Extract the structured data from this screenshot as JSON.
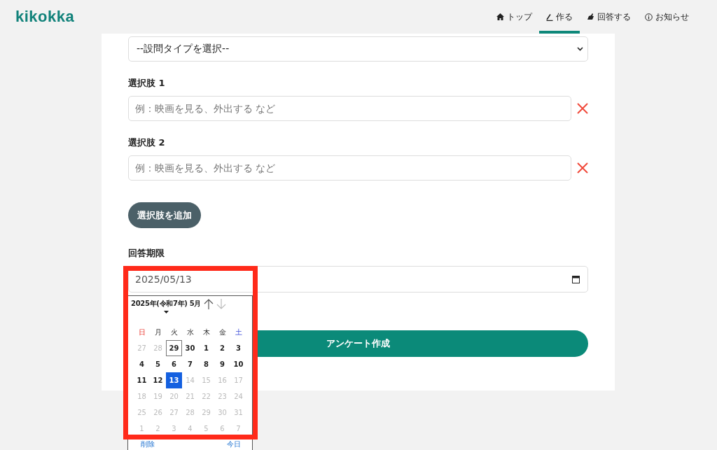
{
  "header": {
    "logo": "kikokka",
    "nav": [
      {
        "label": "トップ",
        "kind": "home",
        "selected": false
      },
      {
        "label": "作る",
        "kind": "create",
        "selected": true
      },
      {
        "label": "回答する",
        "kind": "answer",
        "selected": false
      },
      {
        "label": "お知らせ",
        "kind": "notice",
        "selected": false
      }
    ]
  },
  "form": {
    "question_type_select": {
      "value": "--設問タイプを選択--"
    },
    "choices": [
      {
        "label": "選択肢 1",
        "placeholder": "例：映画を見る、外出する など"
      },
      {
        "label": "選択肢 2",
        "placeholder": "例：映画を見る、外出する など"
      }
    ],
    "add_choice_button": "選択肢を追加",
    "deadline": {
      "label": "回答期限",
      "value": "2025/05/13"
    },
    "submit_button": "アンケート作成"
  },
  "date_picker": {
    "month_label": "2025年(令和7年) 5月",
    "weekdays": [
      {
        "label": "日",
        "kind": "sunday"
      },
      {
        "label": "月",
        "kind": "weekday"
      },
      {
        "label": "火",
        "kind": "weekday"
      },
      {
        "label": "水",
        "kind": "weekday"
      },
      {
        "label": "木",
        "kind": "weekday"
      },
      {
        "label": "金",
        "kind": "weekday"
      },
      {
        "label": "土",
        "kind": "saturday"
      }
    ],
    "weeks": [
      [
        {
          "day": "27",
          "disabled": true,
          "today": false,
          "selected": false
        },
        {
          "day": "28",
          "disabled": true,
          "today": false,
          "selected": false
        },
        {
          "day": "29",
          "disabled": false,
          "today": true,
          "selected": false
        },
        {
          "day": "30",
          "disabled": false,
          "today": false,
          "selected": false
        },
        {
          "day": "1",
          "disabled": false,
          "today": false,
          "selected": false
        },
        {
          "day": "2",
          "disabled": false,
          "today": false,
          "selected": false
        },
        {
          "day": "3",
          "disabled": false,
          "today": false,
          "selected": false
        }
      ],
      [
        {
          "day": "4",
          "disabled": false,
          "today": false,
          "selected": false
        },
        {
          "day": "5",
          "disabled": false,
          "today": false,
          "selected": false
        },
        {
          "day": "6",
          "disabled": false,
          "today": false,
          "selected": false
        },
        {
          "day": "7",
          "disabled": false,
          "today": false,
          "selected": false
        },
        {
          "day": "8",
          "disabled": false,
          "today": false,
          "selected": false
        },
        {
          "day": "9",
          "disabled": false,
          "today": false,
          "selected": false
        },
        {
          "day": "10",
          "disabled": false,
          "today": false,
          "selected": false
        }
      ],
      [
        {
          "day": "11",
          "disabled": false,
          "today": false,
          "selected": false
        },
        {
          "day": "12",
          "disabled": false,
          "today": false,
          "selected": false
        },
        {
          "day": "13",
          "disabled": false,
          "today": false,
          "selected": true
        },
        {
          "day": "14",
          "disabled": true,
          "today": false,
          "selected": false
        },
        {
          "day": "15",
          "disabled": true,
          "today": false,
          "selected": false
        },
        {
          "day": "16",
          "disabled": true,
          "today": false,
          "selected": false
        },
        {
          "day": "17",
          "disabled": true,
          "today": false,
          "selected": false
        }
      ],
      [
        {
          "day": "18",
          "disabled": true,
          "today": false,
          "selected": false
        },
        {
          "day": "19",
          "disabled": true,
          "today": false,
          "selected": false
        },
        {
          "day": "20",
          "disabled": true,
          "today": false,
          "selected": false
        },
        {
          "day": "21",
          "disabled": true,
          "today": false,
          "selected": false
        },
        {
          "day": "22",
          "disabled": true,
          "today": false,
          "selected": false
        },
        {
          "day": "23",
          "disabled": true,
          "today": false,
          "selected": false
        },
        {
          "day": "24",
          "disabled": true,
          "today": false,
          "selected": false
        }
      ],
      [
        {
          "day": "25",
          "disabled": true,
          "today": false,
          "selected": false
        },
        {
          "day": "26",
          "disabled": true,
          "today": false,
          "selected": false
        },
        {
          "day": "27",
          "disabled": true,
          "today": false,
          "selected": false
        },
        {
          "day": "28",
          "disabled": true,
          "today": false,
          "selected": false
        },
        {
          "day": "29",
          "disabled": true,
          "today": false,
          "selected": false
        },
        {
          "day": "30",
          "disabled": true,
          "today": false,
          "selected": false
        },
        {
          "day": "31",
          "disabled": true,
          "today": false,
          "selected": false
        }
      ],
      [
        {
          "day": "1",
          "disabled": true,
          "today": false,
          "selected": false
        },
        {
          "day": "2",
          "disabled": true,
          "today": false,
          "selected": false
        },
        {
          "day": "3",
          "disabled": true,
          "today": false,
          "selected": false
        },
        {
          "day": "4",
          "disabled": true,
          "today": false,
          "selected": false
        },
        {
          "day": "5",
          "disabled": true,
          "today": false,
          "selected": false
        },
        {
          "day": "6",
          "disabled": true,
          "today": false,
          "selected": false
        },
        {
          "day": "7",
          "disabled": true,
          "today": false,
          "selected": false
        }
      ]
    ],
    "clear_button": "削除",
    "today_button": "今日"
  }
}
